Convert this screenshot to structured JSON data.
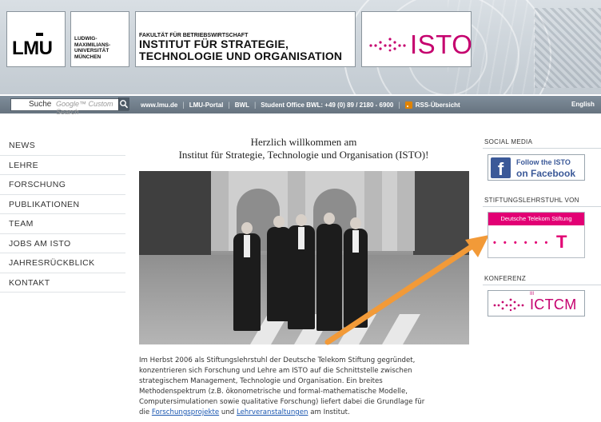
{
  "header": {
    "lmu_logo": "LMU",
    "university_lines": [
      "LUDWIG-",
      "MAXIMILIANS-",
      "UNIVERSITÄT",
      "MÜNCHEN"
    ],
    "faculty_small": "FAKULTÄT FÜR BETRIEBSWIRTSCHAFT",
    "institute_line1": "INSTITUT FÜR STRATEGIE,",
    "institute_line2": "TECHNOLOGIE UND ORGANISATION",
    "isto_logo": "ISTO"
  },
  "navbar": {
    "search_label": "Suche",
    "search_placeholder": "Google™ Custom Search",
    "links": [
      "www.lmu.de",
      "LMU-Portal",
      "BWL",
      "Student Office BWL: +49 (0) 89 / 2180 - 6900",
      "RSS-Übersicht"
    ],
    "english": "English"
  },
  "sidebar": {
    "items": [
      {
        "label": "NEWS"
      },
      {
        "label": "LEHRE"
      },
      {
        "label": "FORSCHUNG"
      },
      {
        "label": "PUBLIKATIONEN"
      },
      {
        "label": "TEAM"
      },
      {
        "label": "JOBS AM ISTO"
      },
      {
        "label": "JAHRESRÜCKBLICK"
      },
      {
        "label": "KONTAKT"
      }
    ]
  },
  "main": {
    "welcome_line1": "Herzlich willkommen am",
    "welcome_line2": "Institut für Strategie, Technologie und Organisation (ISTO)!",
    "para_line1": "Im Herbst 2006 als Stiftungslehrstuhl der Deutsche Telekom Stiftung gegründet,",
    "para_line2": "konzentrieren sich Forschung und Lehre am ISTO auf die Schnittstelle zwischen",
    "para_line3": "strategischem Management, Technologie und Organisation. Ein breites",
    "para_line4": "Methodenspektrum (z.B. ökonometrische und formal-mathematische Modelle,",
    "para_line5": "Computersimulationen sowie qualitative Forschung) liefert dabei die Grundlage für",
    "para_line6_prefix": "die",
    "link_forschung": "Forschungsprojekte",
    "para_und": "und",
    "link_lehre": "Lehrveranstaltungen",
    "para_suffix": "am Institut."
  },
  "rightcol": {
    "social_heading": "SOCIAL MEDIA",
    "fb_line1": "Follow the ISTO",
    "fb_line2": "on Facebook",
    "stiftung_heading": "STIFTUNGSLEHRSTUHL VON",
    "dt_banner": "Deutsche Telekom Stiftung",
    "dt_dots": "• • • • • •",
    "dt_t": "T",
    "konferenz_heading": "KONFERENZ",
    "ictcm_num": "III",
    "ictcm_text": "ICTCM"
  },
  "colors": {
    "magenta": "#c5006e",
    "telekom_magenta": "#e20074",
    "facebook_blue": "#3b5998",
    "nav_bar": "#6e7b87",
    "link_blue": "#1a56b0",
    "arrow_orange": "#f29a38"
  },
  "icons": [
    "search-icon",
    "rss-icon",
    "facebook-icon",
    "arrow-annotation"
  ]
}
